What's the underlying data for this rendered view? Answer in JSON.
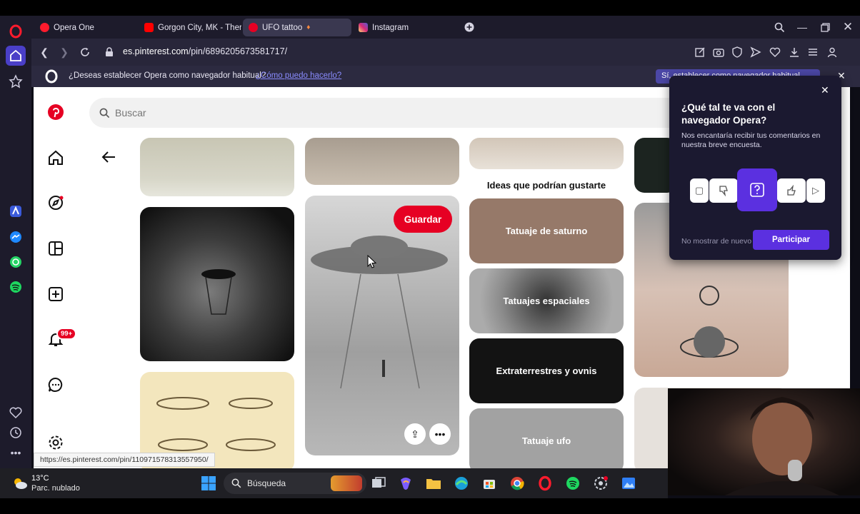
{
  "browser": {
    "tabs": [
      {
        "label": "Opera One",
        "favicon_color": "#ff1b2d"
      },
      {
        "label": "Gorgon City, MK - There F",
        "favicon_color": "#ff0000"
      },
      {
        "label": "UFO tattoo",
        "favicon_color": "#e60023"
      },
      {
        "label": "Instagram",
        "favicon_color": "#d6249f"
      }
    ],
    "url_host": "es.pinterest.com",
    "url_path": "/pin/6896205673581717/",
    "infobar": {
      "question": "¿Deseas establecer Opera como navegador habitual?",
      "link": "¿Cómo puedo hacerlo?",
      "button": "Sí, establecer como navegador habitual"
    }
  },
  "pinterest": {
    "search_placeholder": "Buscar",
    "notification_badge": "99+",
    "ideas_heading": "Ideas que podrían gustarte",
    "save_button": "Guardar",
    "idea_cards": [
      "Tatuaje de saturno",
      "Tatuajes espaciales",
      "Extraterrestres y ovnis",
      "Tatuaje ufo"
    ]
  },
  "survey": {
    "title": "¿Qué tal te va con el navegador Opera?",
    "body": "Nos encantaría recibir tus comentarios en nuestra breve encuesta.",
    "dismiss": "No mostrar de nuevo",
    "participate": "Participar"
  },
  "status_url": "https://es.pinterest.com/pin/110971578313557950/",
  "taskbar": {
    "temperature": "13°C",
    "weather": "Parc. nublado",
    "search_label": "Búsqueda"
  },
  "colors": {
    "pinterest_red": "#e60023",
    "opera_red": "#ff1b2d",
    "opera_purple": "#5b30e0"
  }
}
